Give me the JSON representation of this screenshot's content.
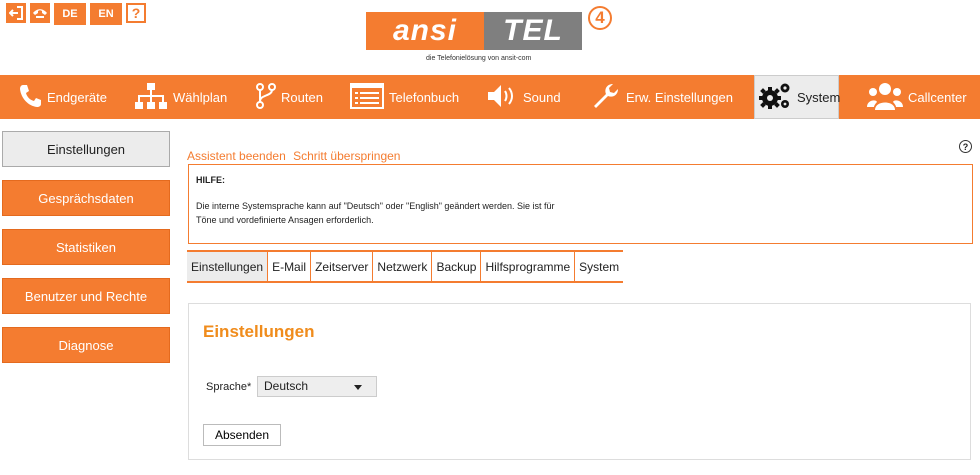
{
  "topbar": {
    "lang_de": "DE",
    "lang_en": "EN",
    "help": "?"
  },
  "logo": {
    "left_text": "ansi",
    "right_text": "TEL",
    "version": "4",
    "tagline": "die Telefonielösung von ansit-com",
    "colors": {
      "brand": "#f47c30",
      "secondary": "#7f7f7f"
    }
  },
  "nav": {
    "items": [
      {
        "label": "Endgeräte",
        "icon": "phone-icon"
      },
      {
        "label": "Wählplan",
        "icon": "sitemap-icon"
      },
      {
        "label": "Routen",
        "icon": "route-icon"
      },
      {
        "label": "Telefonbuch",
        "icon": "list-icon"
      },
      {
        "label": "Sound",
        "icon": "speaker-icon"
      },
      {
        "label": "Erw. Einstellungen",
        "icon": "wrench-icon"
      },
      {
        "label": "System",
        "icon": "gears-icon",
        "active": true
      },
      {
        "label": "Callcenter",
        "icon": "users-icon"
      }
    ]
  },
  "sidebar": {
    "items": [
      {
        "label": "Einstellungen",
        "active": true
      },
      {
        "label": "Gesprächsdaten"
      },
      {
        "label": "Statistiken"
      },
      {
        "label": "Benutzer und Rechte"
      },
      {
        "label": "Diagnose"
      }
    ]
  },
  "assistant": {
    "end": "Assistent beenden",
    "skip": "Schritt überspringen"
  },
  "help_icon": "?",
  "helpbox": {
    "title": "HILFE:",
    "line1": "Die interne Systemsprache kann auf \"Deutsch\" oder \"English\" geändert werden. Sie ist für",
    "line2": "Töne und vordefinierte Ansagen erforderlich."
  },
  "tabs": [
    {
      "label": "Einstellungen",
      "active": true
    },
    {
      "label": "E-Mail"
    },
    {
      "label": "Zeitserver"
    },
    {
      "label": "Netzwerk"
    },
    {
      "label": "Backup"
    },
    {
      "label": "Hilfsprogramme"
    },
    {
      "label": "System"
    }
  ],
  "form": {
    "title": "Einstellungen",
    "language_label": "Sprache*",
    "language_value": "Deutsch",
    "submit_label": "Absenden"
  }
}
